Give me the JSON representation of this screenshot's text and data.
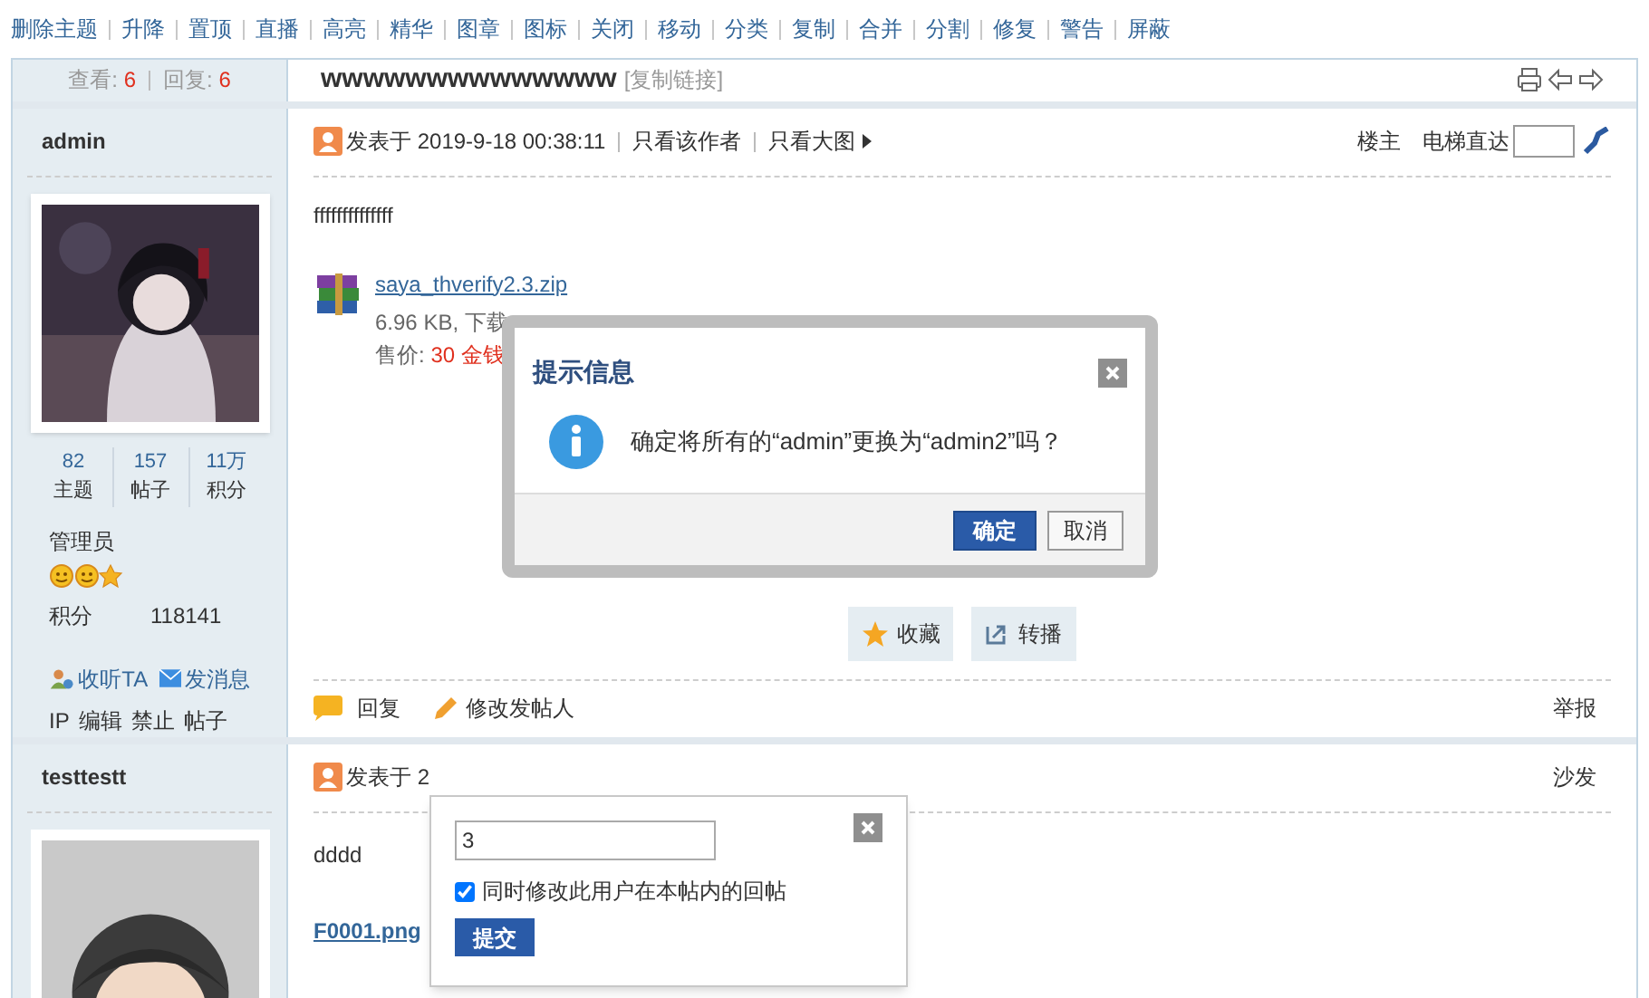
{
  "mod_actions": [
    "删除主题",
    "升降",
    "置顶",
    "直播",
    "高亮",
    "精华",
    "图章",
    "图标",
    "关闭",
    "移动",
    "分类",
    "复制",
    "合并",
    "分割",
    "修复",
    "警告",
    "屏蔽"
  ],
  "thread": {
    "views_label": "查看:",
    "views": "6",
    "replies_label": "回复:",
    "replies": "6",
    "title": "wwwwwwwwwwwwww",
    "copy_link": "[复制链接]"
  },
  "posts": [
    {
      "author": "admin",
      "stats": [
        {
          "value": "82",
          "label": "主题"
        },
        {
          "value": "157",
          "label": "帖子"
        },
        {
          "value": "11万",
          "label": "积分"
        }
      ],
      "group": "管理员",
      "credits_label": "积分",
      "credits": "118141",
      "social": [
        "收听TA",
        "发消息"
      ],
      "admin_links": [
        "IP",
        "编辑",
        "禁止",
        "帖子"
      ],
      "posted_label": "发表于",
      "time": "2019-9-18 00:38:11",
      "links": [
        "只看该作者",
        "只看大图"
      ],
      "floor": "楼主",
      "jump_label": "电梯直达",
      "body": "ffffffffffffff",
      "attachment": {
        "name": "saya_thverify2.3.zip",
        "meta": "6.96 KB, 下载",
        "price_label": "售价:",
        "price": "30 金钱"
      },
      "buttons": [
        "收藏",
        "转播"
      ],
      "footer": [
        "回复",
        "修改发帖人"
      ],
      "report": "举报"
    },
    {
      "author": "testtestt",
      "posted_label": "发表于",
      "time": "2",
      "floor": "沙发",
      "body": "dddd",
      "attachment": {
        "name": "F0001.png"
      }
    }
  ],
  "dialog": {
    "title": "提示信息",
    "message": "确定将所有的“admin”更换为“admin2”吗？",
    "confirm": "确定",
    "cancel": "取消"
  },
  "popup": {
    "value": "3",
    "checkbox": {
      "label": "同时修改此用户在本帖内的回帖",
      "checked": true
    },
    "submit": "提交"
  }
}
